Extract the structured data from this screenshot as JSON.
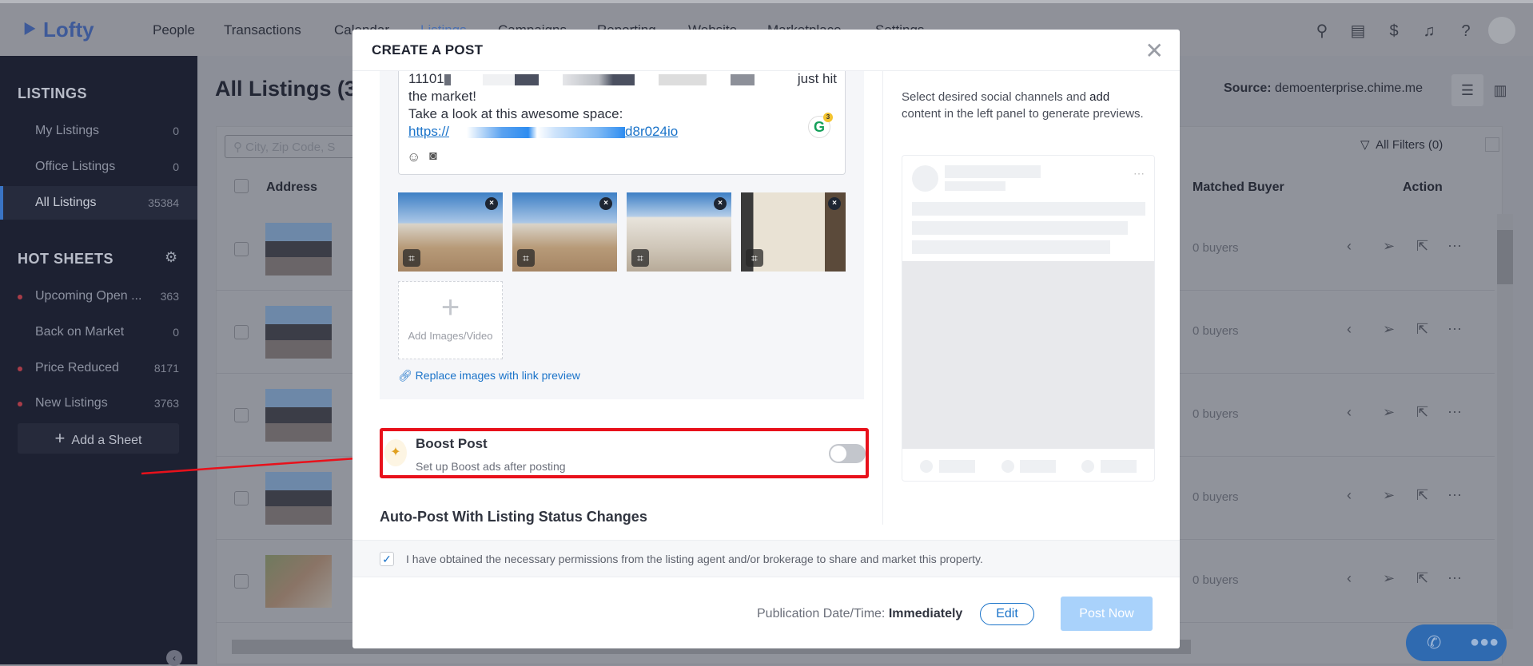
{
  "nav": {
    "brand": "Lofty",
    "items": [
      "People",
      "Transactions",
      "Calendar",
      "Listings",
      "Campaigns",
      "Reporting",
      "Website",
      "Marketplace",
      "Settings"
    ],
    "active": "Listings"
  },
  "sidebar": {
    "listings_heading": "LISTINGS",
    "listings": [
      {
        "label": "My Listings",
        "count": "0"
      },
      {
        "label": "Office Listings",
        "count": "0"
      },
      {
        "label": "All Listings",
        "count": "35384"
      }
    ],
    "hot_heading": "HOT SHEETS",
    "hot": [
      {
        "label": "Upcoming Open ...",
        "count": "363"
      },
      {
        "label": "Back on Market",
        "count": "0"
      },
      {
        "label": "Price Reduced",
        "count": "8171"
      },
      {
        "label": "New Listings",
        "count": "3763"
      }
    ],
    "add_sheet": "Add a Sheet"
  },
  "main": {
    "title": "All Listings (3",
    "source_label": "Source:",
    "source_value": "demoenterprise.chime.me",
    "search_placeholder": "City, Zip Code, S",
    "filters": "All Filters (0)",
    "columns": {
      "address": "Address",
      "matched": "Matched Buyer",
      "action": "Action"
    },
    "rows": [
      "0 buyers",
      "0 buyers",
      "0 buyers",
      "0 buyers",
      "0 buyers"
    ]
  },
  "modal": {
    "title": "CREATE A POST",
    "text": {
      "line1_start": "11101",
      "line1_end": "just hit",
      "line2": "the market!",
      "line3": "Take a look at this awesome space:",
      "link_start": "https://",
      "link_end": "d8r024io",
      "grammarly_count": "3"
    },
    "add_images": "Add Images/Video",
    "replace_link": "Replace images with link preview",
    "boost": {
      "title": "Boost Post",
      "subtitle": "Set up Boost ads after posting",
      "enabled": false
    },
    "auto_post": "Auto-Post With Listing Status Changes",
    "preview_hint_1": "Select desired social channels and ",
    "preview_hint_bold": "add",
    "preview_hint_2": " content in the left panel to generate previews.",
    "permission": "I have obtained the necessary permissions from the listing agent and/or brokerage to share and market this property.",
    "permission_checked": true,
    "pub_label": "Publication Date/Time:",
    "pub_value": "Immediately",
    "edit": "Edit",
    "post_now": "Post Now"
  },
  "colors": {
    "accent": "#1a73c9",
    "highlight": "#e8111b",
    "sidebar": "#1d2132"
  }
}
